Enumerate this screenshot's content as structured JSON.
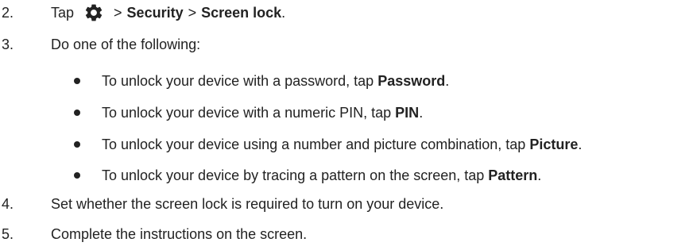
{
  "steps": [
    {
      "number": "2.",
      "prefix": "Tap",
      "icon": "gear-icon",
      "separator1": ">",
      "menu1": "Security",
      "separator2": ">",
      "menu2": "Screen lock",
      "suffix": "."
    },
    {
      "number": "3.",
      "text": "Do one of the following:"
    },
    {
      "number": "4.",
      "text": "Set whether the screen lock is required to turn on your device."
    },
    {
      "number": "5.",
      "text": "Complete the instructions on the screen."
    }
  ],
  "bullets": [
    {
      "text": "To unlock your device with a password, tap ",
      "bold": "Password",
      "suffix": "."
    },
    {
      "text": "To unlock your device with a numeric PIN, tap ",
      "bold": "PIN",
      "suffix": "."
    },
    {
      "text": "To unlock your device using a number and picture combination, tap ",
      "bold": "Picture",
      "suffix": "."
    },
    {
      "text": "To unlock your device by tracing a pattern on the screen, tap ",
      "bold": "Pattern",
      "suffix": "."
    }
  ]
}
